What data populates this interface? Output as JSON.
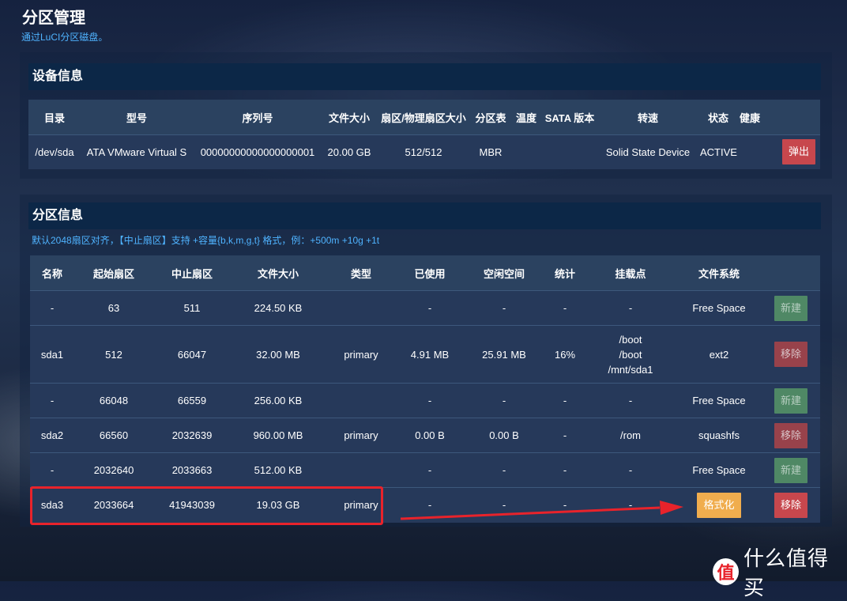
{
  "page": {
    "title": "分区管理",
    "description": "通过LuCI分区磁盘。"
  },
  "device": {
    "section_title": "设备信息",
    "headers": [
      "目录",
      "型号",
      "序列号",
      "文件大小",
      "扇区/物理扇区大小",
      "分区表",
      "温度",
      "SATA 版本",
      "转速",
      "状态",
      "健康"
    ],
    "row": {
      "path": "/dev/sda",
      "model": "ATA VMware Virtual S",
      "serial": "00000000000000000001",
      "size": "20.00 GB",
      "sector_size": "512/512",
      "partition_table": "MBR",
      "temperature": "",
      "sata_version": "",
      "rotation": "Solid State Device",
      "status": "ACTIVE",
      "health": "",
      "eject_label": "弹出"
    }
  },
  "partitions": {
    "section_title": "分区信息",
    "hint": "默认2048扇区对齐，【中止扇区】支持 +容量{b,k,m,g,t} 格式，例：+500m +10g +1t",
    "headers": [
      "名称",
      "起始扇区",
      "中止扇区",
      "文件大小",
      "类型",
      "已使用",
      "空闲空间",
      "统计",
      "挂载点",
      "文件系统"
    ],
    "rows": [
      {
        "name": "-",
        "start": "63",
        "end": "511",
        "size": "224.50 KB",
        "type": "",
        "used": "-",
        "free": "-",
        "usage": "-",
        "mount": "-",
        "fs": "Free Space",
        "action": "新建"
      },
      {
        "name": "sda1",
        "start": "512",
        "end": "66047",
        "size": "32.00 MB",
        "type": "primary",
        "used": "4.91 MB",
        "free": "25.91 MB",
        "usage": "16%",
        "mount1": "/boot",
        "mount2": "/boot",
        "mount3": "/mnt/sda1",
        "fs": "ext2",
        "action": "移除"
      },
      {
        "name": "-",
        "start": "66048",
        "end": "66559",
        "size": "256.00 KB",
        "type": "",
        "used": "-",
        "free": "-",
        "usage": "-",
        "mount": "-",
        "fs": "Free Space",
        "action": "新建"
      },
      {
        "name": "sda2",
        "start": "66560",
        "end": "2032639",
        "size": "960.00 MB",
        "type": "primary",
        "used": "0.00 B",
        "free": "0.00 B",
        "usage": "-",
        "mount": "/rom",
        "fs": "squashfs",
        "action": "移除"
      },
      {
        "name": "-",
        "start": "2032640",
        "end": "2033663",
        "size": "512.00 KB",
        "type": "",
        "used": "-",
        "free": "-",
        "usage": "-",
        "mount": "-",
        "fs": "Free Space",
        "action": "新建"
      },
      {
        "name": "sda3",
        "start": "2033664",
        "end": "41943039",
        "size": "19.03 GB",
        "type": "primary",
        "used": "-",
        "free": "-",
        "usage": "-",
        "mount": "-",
        "format_label": "格式化",
        "action": "移除"
      }
    ]
  },
  "watermark": {
    "logo": "值",
    "text": "什么值得买"
  },
  "colors": {
    "highlight": "#e8232b",
    "link": "#4fb3ff",
    "danger": "#c7474d",
    "success": "#4f8865",
    "warning": "#f0ad4e"
  }
}
